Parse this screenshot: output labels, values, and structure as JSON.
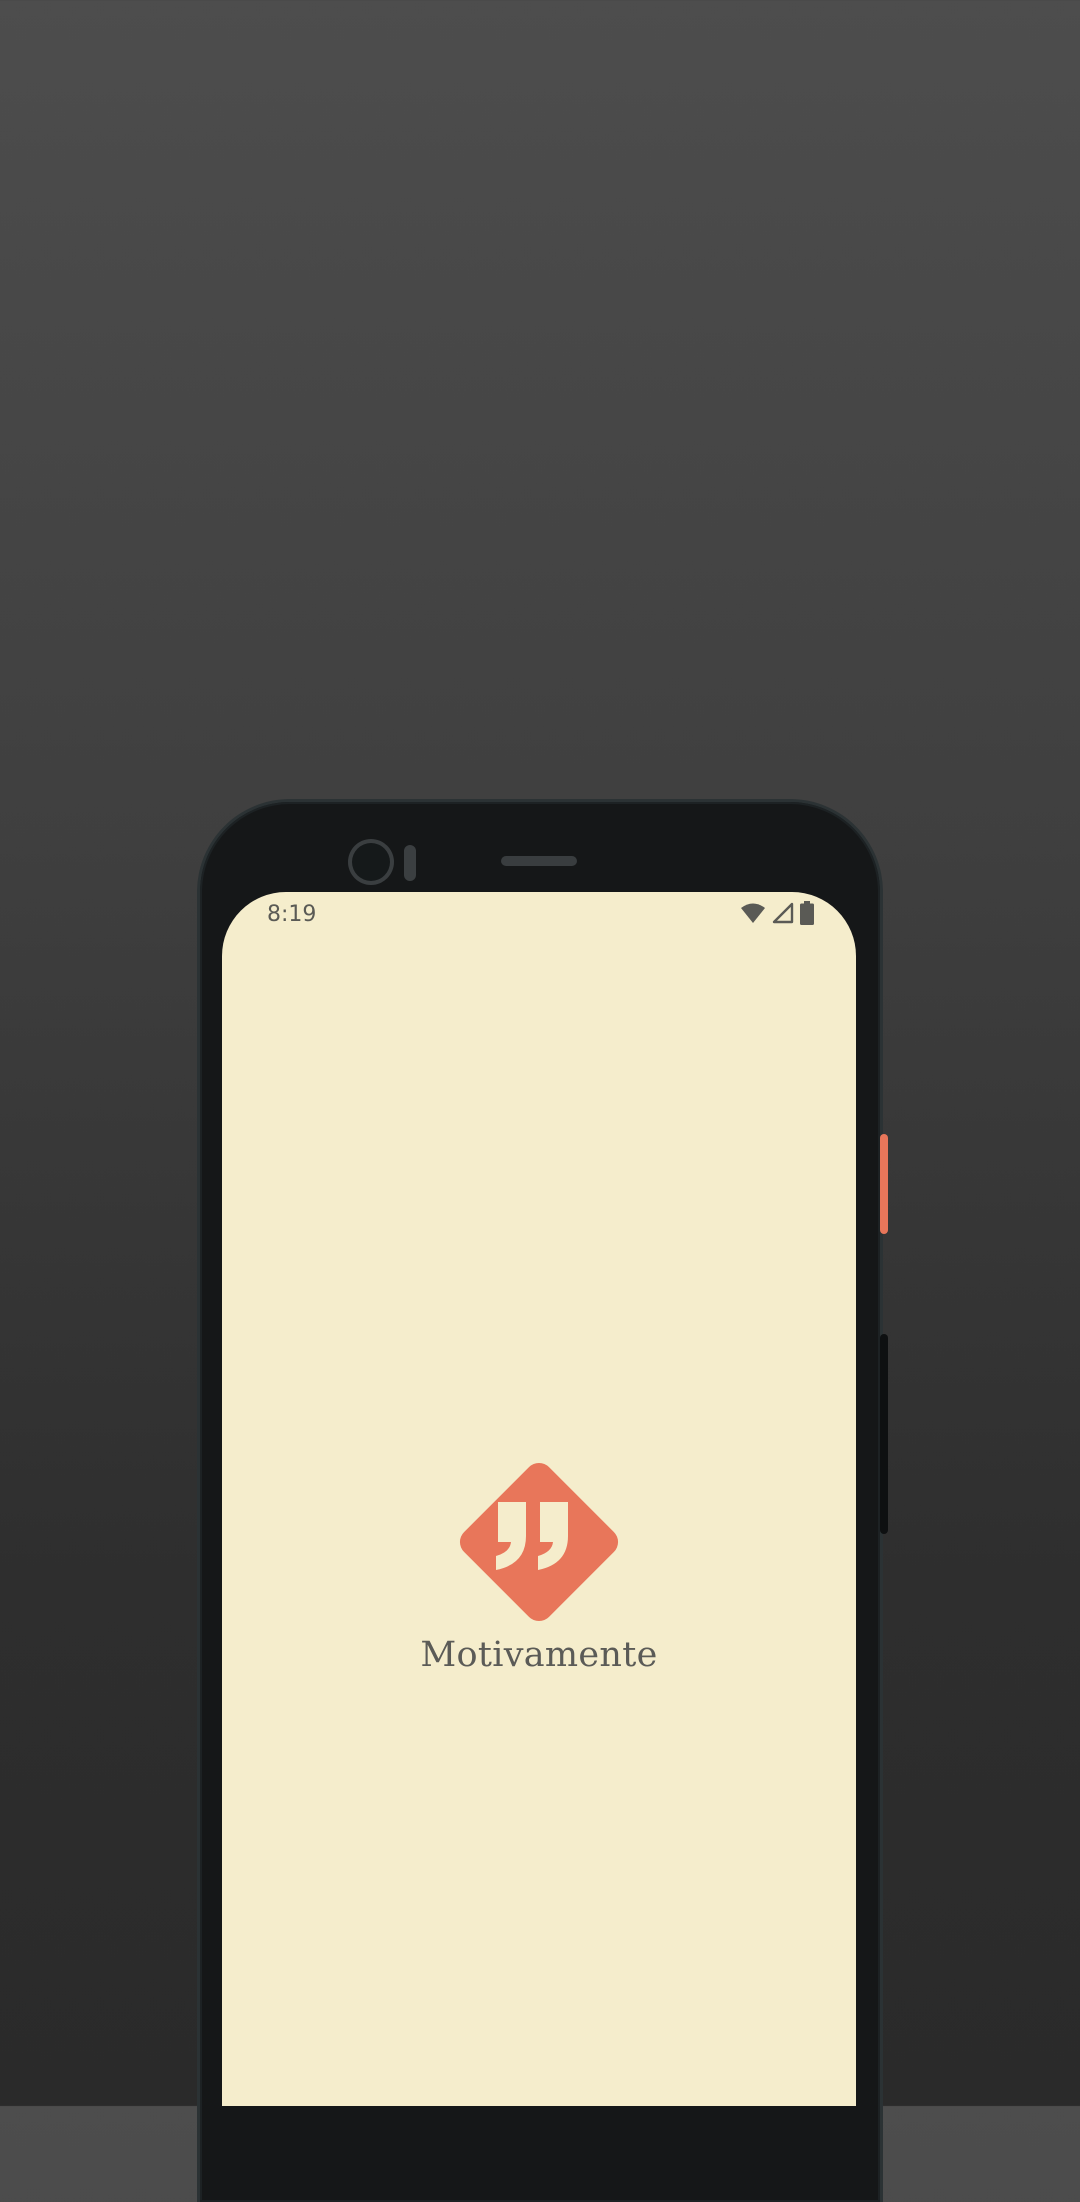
{
  "status_bar": {
    "time": "8:19",
    "icons": [
      "wifi-icon",
      "cell-signal-icon",
      "battery-icon"
    ]
  },
  "splash": {
    "app_name": "Motivamente",
    "logo_icon": "quote-marks-diamond-icon"
  },
  "colors": {
    "screen_background": "#f5edcc",
    "brand_accent": "#e8765a",
    "text": "#5b5b57",
    "phone_frame": "#151718"
  }
}
